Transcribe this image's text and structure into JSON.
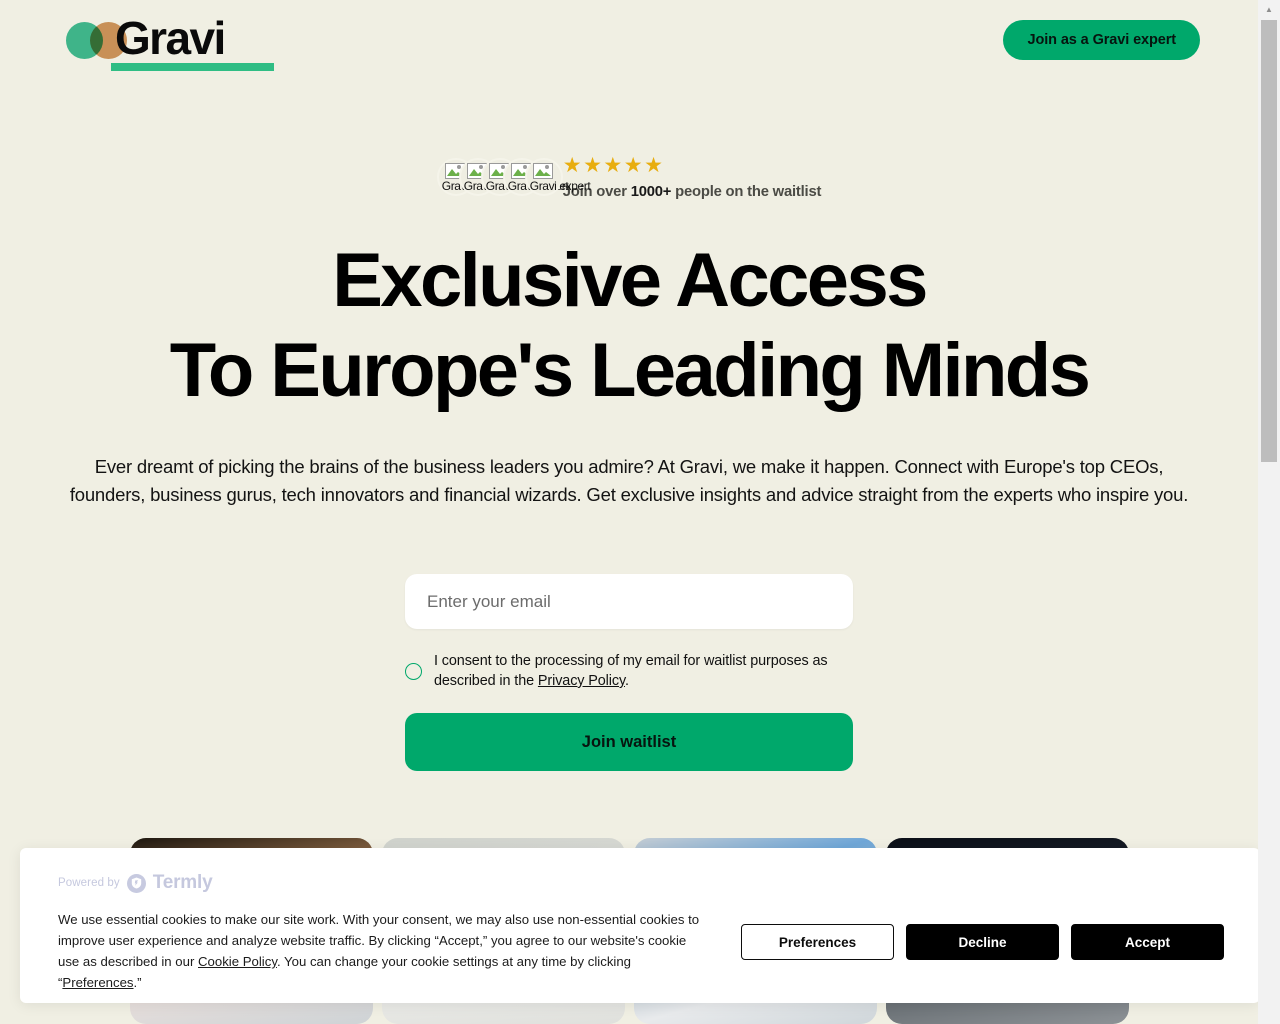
{
  "colors": {
    "page_background": "#f0efe3",
    "accent_green": "#00a86b",
    "logo_green": "#3fb489",
    "logo_orange": "#d59a62",
    "star_gold": "#e8ad0f",
    "cookie_button_black": "#000000",
    "termly_gray": "#c5c8de"
  },
  "header": {
    "logo": {
      "wordmark": "Gravi",
      "circle_green_name": "logo-circle-green",
      "circle_orange_name": "logo-circle-orange"
    },
    "expert_button_label": "Join as a Gravi expert"
  },
  "hero": {
    "social_proof": {
      "avatars": [
        {
          "alt": "Gravi expert"
        },
        {
          "alt": "Gravi expert"
        },
        {
          "alt": "Gravi expert"
        },
        {
          "alt": "Gravi expert"
        },
        {
          "alt": "Gravi expert"
        }
      ],
      "stars": "★★★★★",
      "star_count": 5,
      "waitlist_prefix": "Join over ",
      "waitlist_count": "1000+",
      "waitlist_suffix": " people on the waitlist"
    },
    "headline_line1": "Exclusive Access",
    "headline_line2": "To Europe's Leading Minds",
    "subcopy": "Ever dreamt of picking the brains of the business leaders you admire? At Gravi, we make it happen. Connect with Europe's top CEOs, founders, business gurus, tech innovators and financial wizards. Get exclusive insights and advice straight from the experts who inspire you."
  },
  "signup": {
    "email_placeholder": "Enter your email",
    "email_value": "",
    "consent_checked": false,
    "consent_text_before": "I consent to the processing of my email for waitlist purposes as described in the ",
    "consent_link_label": "Privacy Policy",
    "consent_text_after": ".",
    "submit_label": "Join waitlist"
  },
  "expert_cards": [
    {
      "name": "expert-card-1"
    },
    {
      "name": "expert-card-2"
    },
    {
      "name": "expert-card-3"
    },
    {
      "name": "expert-card-4"
    }
  ],
  "cookie_banner": {
    "powered_by_label": "Powered by",
    "brand": "Termly",
    "body_part1": "We use essential cookies to make our site work. With your consent, we may also use non-essential cookies to improve user experience and analyze website traffic. By clicking “Accept,” you agree to our website's cookie use as described in our ",
    "cookie_policy_link": "Cookie Policy",
    "body_part2": ". You can change your cookie settings at any time by clicking “",
    "preferences_link": "Preferences",
    "body_part3": ".”",
    "buttons": {
      "preferences": "Preferences",
      "decline": "Decline",
      "accept": "Accept"
    }
  },
  "scrollbar": {
    "up_arrow": "▲"
  }
}
